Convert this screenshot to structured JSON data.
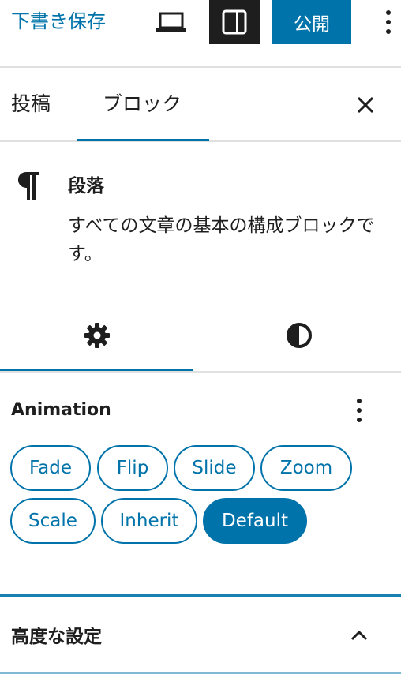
{
  "toolbar": {
    "save_draft_label": "下書き保存",
    "preview_icon": "laptop-icon",
    "settings_icon": "sidebar-toggle-icon",
    "publish_label": "公開",
    "more_icon": "vertical-ellipsis-icon"
  },
  "tabs": {
    "post_label": "投稿",
    "block_label": "ブロック",
    "close_icon": "close-icon"
  },
  "block": {
    "icon": "pilcrow-icon",
    "title": "段落",
    "description": "すべての文章の基本の構成ブロックです。"
  },
  "subtabs": {
    "settings_icon": "gear-icon",
    "styles_icon": "half-circle-contrast-icon"
  },
  "animation": {
    "title": "Animation",
    "options": [
      "Fade",
      "Flip",
      "Slide",
      "Zoom",
      "Scale",
      "Inherit",
      "Default"
    ],
    "selected": "Default"
  },
  "advanced": {
    "title": "高度な設定",
    "chevron_icon": "chevron-up-icon"
  },
  "colors": {
    "accent": "#0073aa",
    "dark": "#1e1e1e",
    "divider": "#e0e0e0"
  }
}
